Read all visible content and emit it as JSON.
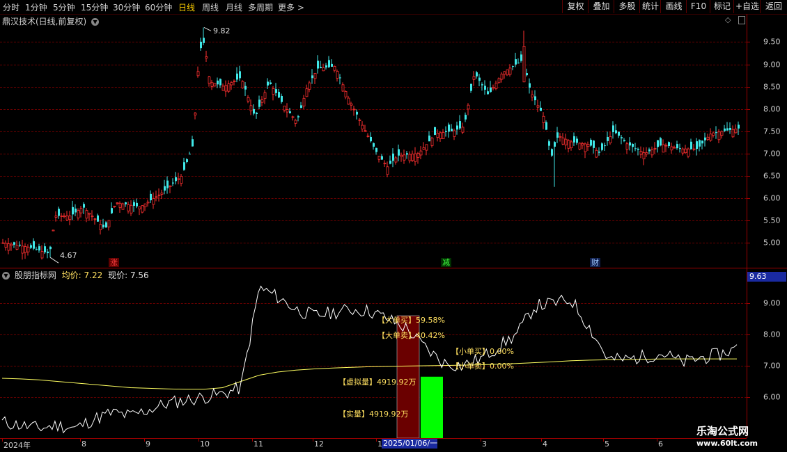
{
  "toolbar": {
    "periods": [
      "分时",
      "1分钟",
      "5分钟",
      "15分钟",
      "30分钟",
      "60分钟",
      "日线",
      "周线",
      "月线",
      "多周期",
      "更多 >"
    ],
    "active_period": "日线",
    "buttons": [
      "复权",
      "叠加",
      "多股",
      "统计",
      "画线",
      "F10",
      "标记",
      "+自选",
      "返回"
    ]
  },
  "main_pane": {
    "title": "鼎汉技术(日线,前复权)",
    "high_label": "9.82",
    "low_label": "4.67",
    "y_labels": [
      "9.50",
      "9.00",
      "8.50",
      "8.00",
      "7.50",
      "7.00",
      "6.50",
      "6.00",
      "5.50",
      "5.00"
    ],
    "markers": [
      {
        "text": "涨",
        "color": "#ff4040",
        "bg": "#600000"
      },
      {
        "text": "减",
        "color": "#40ff40",
        "bg": "#003000"
      },
      {
        "text": "财",
        "color": "#a0c8ff",
        "bg": "#102050"
      }
    ]
  },
  "indicator_pane": {
    "title": "股朋指标网",
    "avg_label": "均价:",
    "avg_value": "7.22",
    "cur_label": "现价:",
    "cur_value": "7.56",
    "cursor_value": "9.63",
    "y_labels": [
      "9.00",
      "8.00",
      "7.00",
      "6.00"
    ],
    "annotations": {
      "big_buy": "【大单买】59.58%",
      "big_sell": "【大单卖】40.42%",
      "small_buy": "【小单买】0.00%",
      "small_sell": "【小单卖】0.00%",
      "virtual_vol": "【虚拟量】4919.92万",
      "real_vol": "【实量】4919.92万"
    },
    "colors": {
      "line": "#ffffff",
      "avg_line": "#ffff60",
      "bar_red": "#6a0000",
      "bar_green": "#00ff00"
    }
  },
  "x_axis": {
    "labels": [
      "2024年",
      "8",
      "9",
      "10",
      "11",
      "12",
      "1",
      "3",
      "4",
      "5",
      "6"
    ],
    "cursor_date": "2025/01/06/一"
  },
  "watermark": {
    "line1": "乐淘公式网",
    "line2": "www.60lt.com"
  },
  "chart_data": {
    "type": "line",
    "title": "股朋指标网",
    "series": [
      {
        "name": "均价",
        "values": [
          6.6,
          6.58,
          6.55,
          6.5,
          6.45,
          6.4,
          6.35,
          6.3,
          6.28,
          6.26,
          6.25,
          6.25,
          6.3,
          6.5,
          6.7,
          6.8,
          6.86,
          6.9,
          6.93,
          6.95,
          6.97,
          6.98,
          6.99,
          7.0,
          7.01,
          7.02,
          7.03,
          7.05,
          7.07,
          7.1,
          7.13,
          7.16,
          7.18,
          7.19,
          7.2,
          7.21,
          7.22,
          7.22,
          7.22,
          7.22,
          7.22
        ]
      },
      {
        "name": "现价",
        "values": [
          5.2,
          5.1,
          5.0,
          5.1,
          5.0,
          5.3,
          5.5,
          5.4,
          5.6,
          5.8,
          5.9,
          6.0,
          6.1,
          6.3,
          9.5,
          9.2,
          8.8,
          8.6,
          8.7,
          8.8,
          8.75,
          8.5,
          8.2,
          7.6,
          7.1,
          7.0,
          7.2,
          7.6,
          8.0,
          8.9,
          9.0,
          9.1,
          8.2,
          7.2,
          7.2,
          7.3,
          7.4,
          7.1,
          7.25,
          7.35,
          7.56
        ]
      }
    ],
    "ylim": [
      5.0,
      9.9
    ]
  }
}
